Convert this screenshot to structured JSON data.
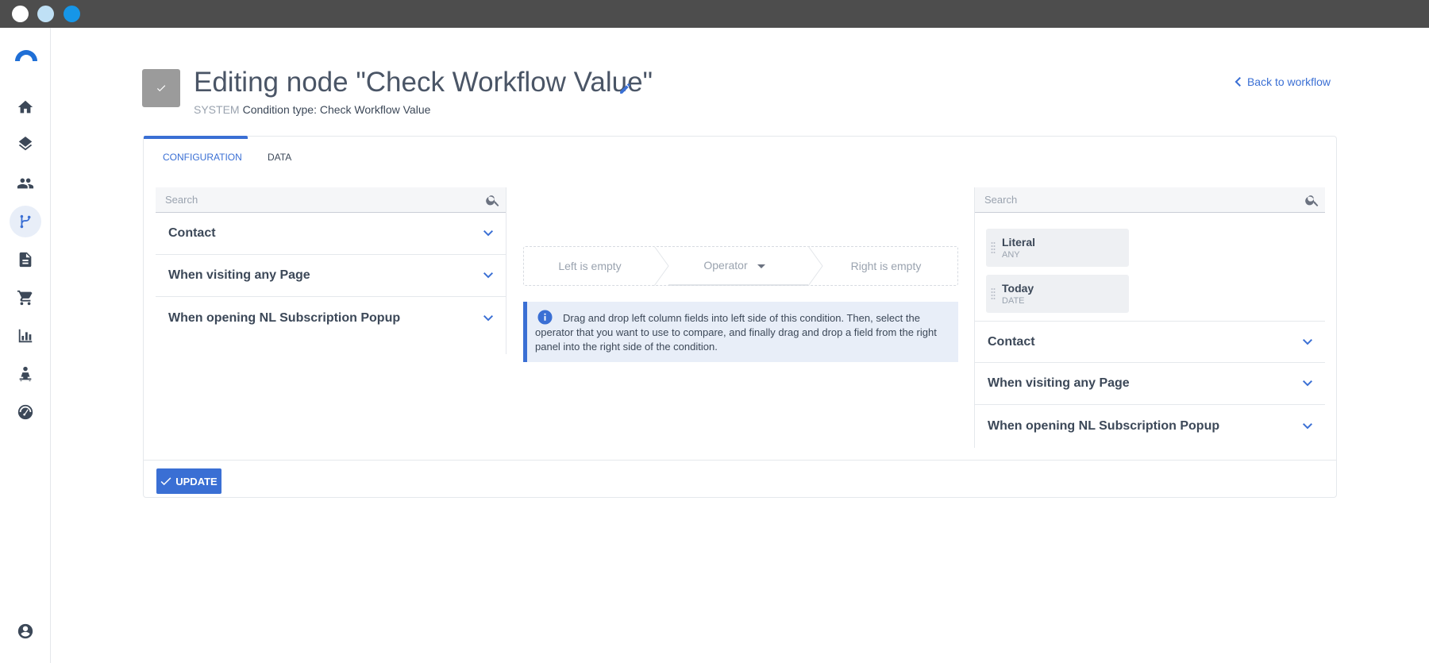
{
  "colors": {
    "accent": "#3a6fd4",
    "titlebar": "#4d4d4d",
    "badge": "#9b9b9b",
    "info_bg": "#e8eef8"
  },
  "sidebar": {
    "items": [
      {
        "icon": "home-icon"
      },
      {
        "icon": "layers-icon"
      },
      {
        "icon": "people-icon"
      },
      {
        "icon": "workflow-icon",
        "active": true
      },
      {
        "icon": "document-icon"
      },
      {
        "icon": "cart-icon"
      },
      {
        "icon": "bar-chart-icon"
      },
      {
        "icon": "org-icon"
      },
      {
        "icon": "dashboard-icon"
      },
      {
        "icon": "account-icon"
      }
    ]
  },
  "header": {
    "title": "Editing node \"Check Workflow Value\"",
    "system_label": "SYSTEM",
    "subtitle": "Condition type: Check Workflow Value",
    "back_label": "Back to workflow"
  },
  "tabs": [
    {
      "label": "CONFIGURATION",
      "active": true
    },
    {
      "label": "DATA",
      "active": false
    }
  ],
  "left_panel": {
    "search_placeholder": "Search",
    "sections": [
      "Contact",
      "When visiting any Page",
      "When opening NL Subscription Popup"
    ]
  },
  "condition": {
    "left": "Left is empty",
    "operator": "Operator",
    "right": "Right is empty",
    "info": "Drag and drop left column fields into left side of this condition. Then, select the operator that you want to use to compare, and finally drag and drop a field from the right panel into the right side of the condition."
  },
  "right_panel": {
    "search_placeholder": "Search",
    "fields": [
      {
        "name": "Literal",
        "type": "ANY"
      },
      {
        "name": "Today",
        "type": "DATE"
      }
    ],
    "sections": [
      "Contact",
      "When visiting any Page",
      "When opening NL Subscription Popup"
    ]
  },
  "footer": {
    "update_label": "UPDATE"
  }
}
